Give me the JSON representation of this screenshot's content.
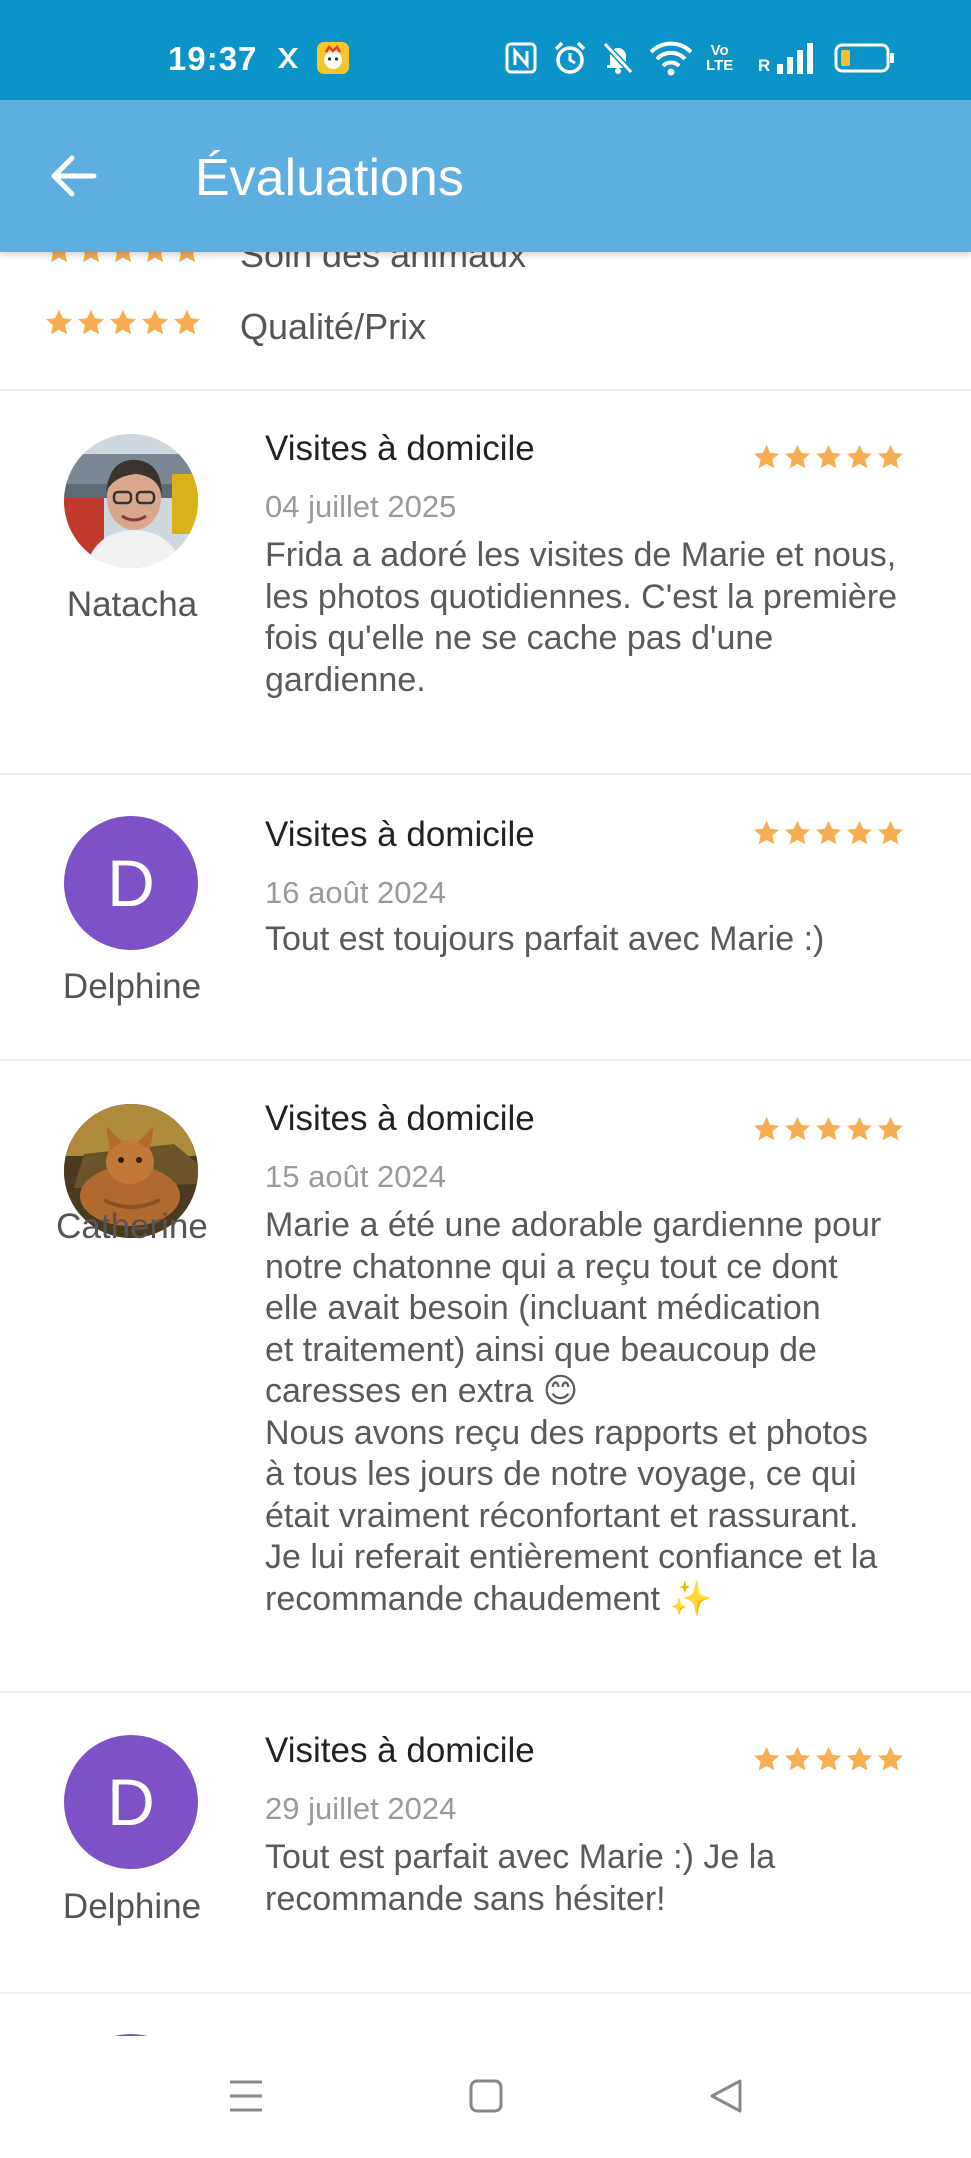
{
  "status_bar": {
    "time": "19:37",
    "icons": [
      "app-icon",
      "notification-icon",
      "nfc-icon",
      "alarm-icon",
      "mute-icon",
      "wifi-icon",
      "volte-icon",
      "signal-icon",
      "battery-icon"
    ],
    "volte_top": "Vo",
    "volte_bottom": "LTE",
    "roaming": "R"
  },
  "app_bar": {
    "title": "Évaluations",
    "back_icon": "back-arrow-icon",
    "background_color": "#5eafe0"
  },
  "criteria": [
    {
      "label": "Soin des animaux",
      "rating": 5
    },
    {
      "label": "Qualité/Prix",
      "rating": 5
    }
  ],
  "star_color": "#f7ad52",
  "reviews": [
    {
      "author": "Natacha",
      "avatar": "photo",
      "service": "Visites à domicile",
      "date": "04 juillet 2025",
      "rating": 5,
      "text": "Frida a adoré les visites de Marie et nous,\nles photos quotidiennes. C'est la première\nfois qu'elle ne se cache pas d'une\ngardienne."
    },
    {
      "author": "Delphine",
      "avatar": "D",
      "service": "Visites à domicile",
      "date": "16 août 2024",
      "rating": 5,
      "text": "Tout est toujours parfait avec Marie :)"
    },
    {
      "author": "Catherine",
      "avatar": "photo",
      "service": "Visites à domicile",
      "date": "15 août 2024",
      "rating": 5,
      "text": "Marie a été une adorable gardienne pour\nnotre chatonne qui a reçu tout ce dont\nelle avait besoin (incluant médication\net traitement) ainsi que beaucoup de\ncaresses en extra 😊\nNous avons reçu des rapports et photos\nà tous les jours de notre voyage, ce qui\nétait vraiment réconfortant et rassurant.\nJe lui referait entièrement confiance et la\nrecommande chaudement ✨"
    },
    {
      "author": "Delphine",
      "avatar": "D",
      "service": "Visites à domicile",
      "date": "29 juillet 2024",
      "rating": 5,
      "text": "Tout est parfait avec Marie :) Je la\nrecommande sans hésiter!"
    }
  ],
  "nav_bar": {
    "buttons": [
      "menu-icon",
      "home-icon",
      "back-triangle-icon"
    ]
  }
}
